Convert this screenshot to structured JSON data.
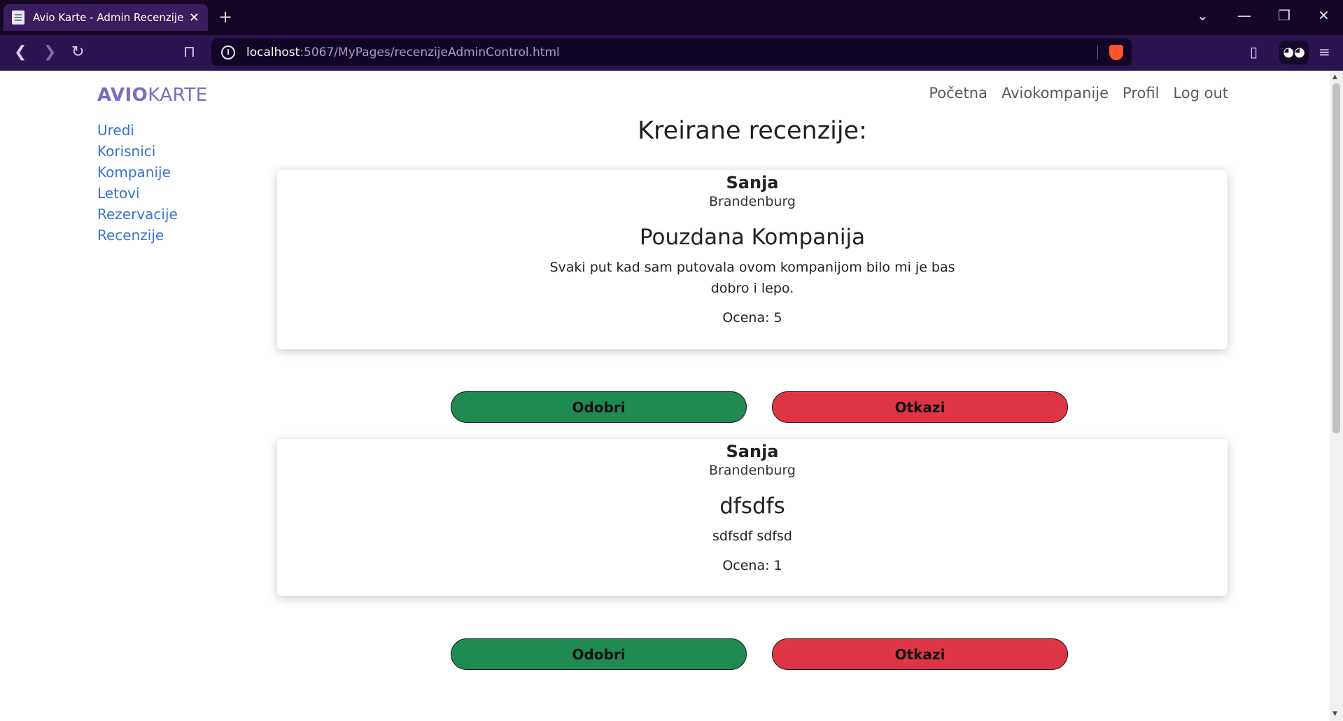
{
  "browser": {
    "tab_title": "Avio Karte - Admin Recenzije",
    "url_host": "localhost",
    "url_path": ":5067/MyPages/recenzijeAdminControl.html"
  },
  "site": {
    "brand_bold": "AVIO",
    "brand_light": "KARTE",
    "topnav": [
      "Početna",
      "Aviokompanije",
      "Profil",
      "Log out"
    ],
    "sidenav": [
      "Uredi",
      "Korisnici",
      "Kompanije",
      "Letovi",
      "Rezervacije",
      "Recenzije"
    ]
  },
  "main": {
    "heading": "Kreirane recenzije:",
    "reviews": [
      {
        "author": "Sanja",
        "location": "Brandenburg",
        "title": "Pouzdana Kompanija",
        "body": "Svaki put kad sam putovala ovom kompanijom bilo mi je bas dobro i lepo.",
        "rating": "Ocena: 5",
        "approve_label": "Odobri",
        "cancel_label": "Otkazi"
      },
      {
        "author": "Sanja",
        "location": "Brandenburg",
        "title": "dfsdfs",
        "body": "sdfsdf sdfsd",
        "rating": "Ocena: 1",
        "approve_label": "Odobri",
        "cancel_label": "Otkazi"
      }
    ]
  },
  "colors": {
    "tabbar": "#150623",
    "toolbar": "#2b1352",
    "brand": "#7b6bc4",
    "sidenav_link": "#3a73d6",
    "approve": "#1f8a52",
    "cancel": "#de3545"
  }
}
